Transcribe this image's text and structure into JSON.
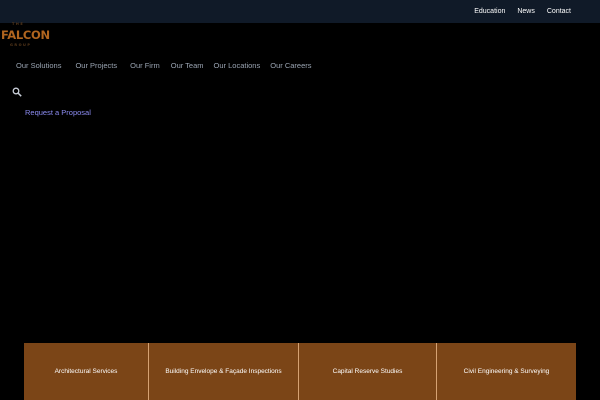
{
  "topbar": {
    "links": [
      "Education",
      "News",
      "Contact"
    ]
  },
  "logo": {
    "top_text": "THE",
    "word": "FALCON",
    "bottom_text": "GROUP"
  },
  "nav": {
    "items": [
      "Our Solutions",
      "Our Projects",
      "Our Firm",
      "Our Team",
      "Our Locations",
      "Our Careers"
    ]
  },
  "search": {
    "icon": "search-icon"
  },
  "cta": {
    "label": "Request a Proposal"
  },
  "services": {
    "tiles": [
      "Architectural Services",
      "Building Envelope & Façade Inspections",
      "Capital Reserve Studies",
      "Civil Engineering & Surveying"
    ]
  },
  "colors": {
    "topbar_bg": "#101a28",
    "brand_orange": "#b0651f",
    "services_bg": "#7b4517",
    "cta_link": "#8c8cf2"
  }
}
